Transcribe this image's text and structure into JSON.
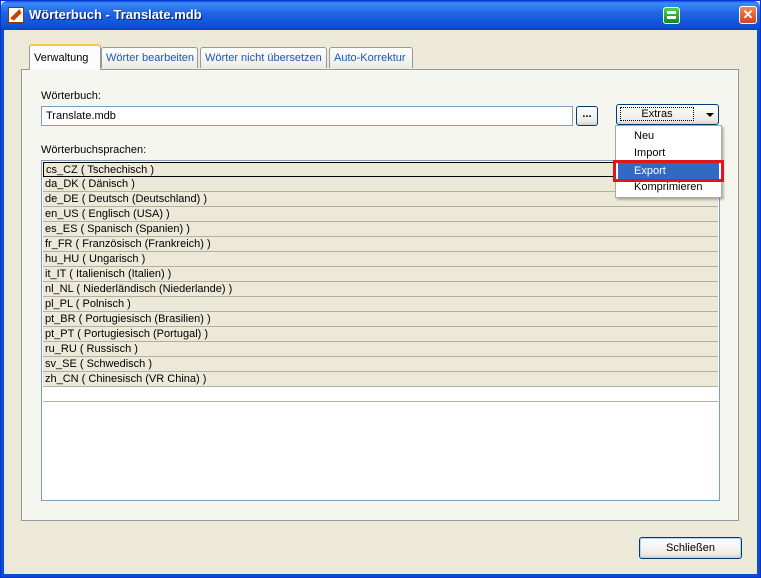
{
  "window": {
    "title": "Wörterbuch - Translate.mdb"
  },
  "tabs": [
    {
      "label": "Verwaltung",
      "active": true
    },
    {
      "label": "Wörter bearbeiten"
    },
    {
      "label": "Wörter nicht übersetzen"
    },
    {
      "label": "Auto-Korrektur"
    }
  ],
  "dictionary": {
    "label": "Wörterbuch:",
    "value": "Translate.mdb",
    "browse_label": "...",
    "extras_label": "Extras"
  },
  "menu": {
    "items": [
      "Neu",
      "Import",
      "Export",
      "Komprimieren"
    ],
    "highlighted": "Export"
  },
  "languages": {
    "label": "Wörterbuchsprachen:",
    "items": [
      "cs_CZ ( Tschechisch )",
      "da_DK ( Dänisch )",
      "de_DE ( Deutsch (Deutschland) )",
      "en_US ( Englisch (USA) )",
      "es_ES ( Spanisch (Spanien) )",
      "fr_FR ( Französisch (Frankreich) )",
      "hu_HU ( Ungarisch )",
      "it_IT ( Italienisch (Italien) )",
      "nl_NL ( Niederländisch (Niederlande) )",
      "pl_PL ( Polnisch )",
      "pt_BR ( Portugiesisch (Brasilien) )",
      "pt_PT ( Portugiesisch (Portugal) )",
      "ru_RU ( Russisch )",
      "sv_SE ( Schwedisch )",
      "zh_CN ( Chinesisch (VR China) )"
    ]
  },
  "footer": {
    "close_label": "Schließen"
  },
  "colors": {
    "accent": "#316AC5",
    "highlight_box": "#E0161B",
    "titlebar": "#0A52D6"
  }
}
